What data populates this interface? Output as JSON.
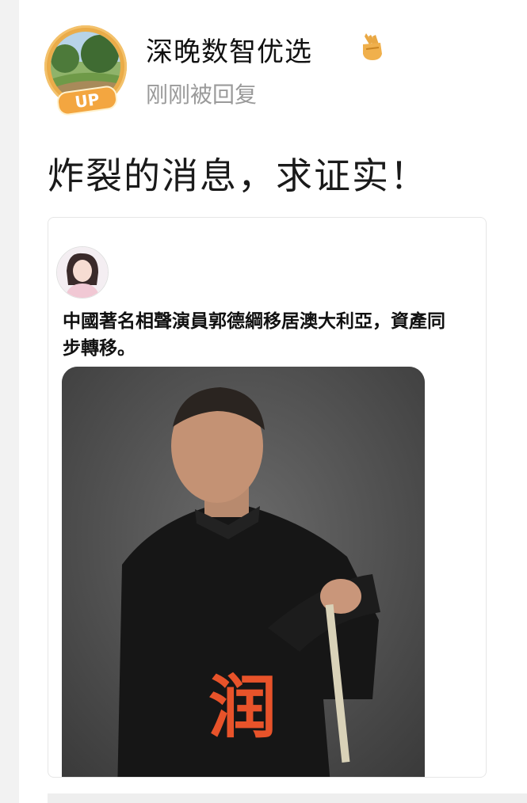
{
  "post": {
    "author_name": "深晚数智优选",
    "status_text": "刚刚被回复",
    "body_text": "炸裂的消息，求证实！",
    "avatar_badge": "UP",
    "verify_icon": "thumbs-up-badge-icon"
  },
  "embed": {
    "text": "中國著名相聲演員郭德綱移居澳大利亞，資產同步轉移。",
    "overlay_char": "润"
  },
  "colors": {
    "badge_gold": "#e9a844",
    "overlay_red": "#e8532a",
    "status_gray": "#9a9a9a"
  }
}
